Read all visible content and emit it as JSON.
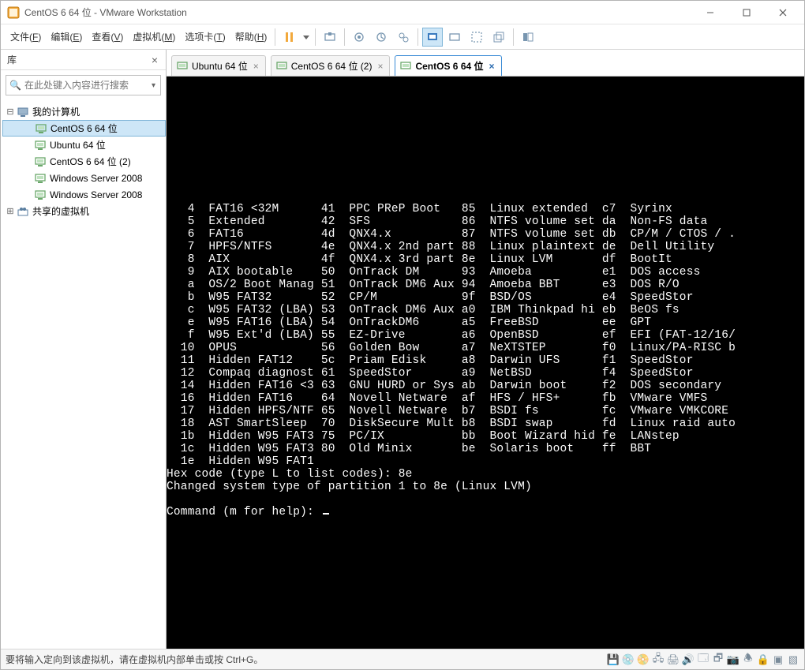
{
  "window": {
    "title": "CentOS 6 64 位 - VMware Workstation"
  },
  "menu": {
    "items": [
      {
        "label": "文件",
        "accel": "F"
      },
      {
        "label": "编辑",
        "accel": "E"
      },
      {
        "label": "查看",
        "accel": "V"
      },
      {
        "label": "虚拟机",
        "accel": "M"
      },
      {
        "label": "选项卡",
        "accel": "T"
      },
      {
        "label": "帮助",
        "accel": "H"
      }
    ]
  },
  "sidebar": {
    "title": "库",
    "search_placeholder": "在此处键入内容进行搜索",
    "root": {
      "label": "我的计算机"
    },
    "items": [
      {
        "label": "CentOS 6 64 位",
        "selected": true
      },
      {
        "label": "Ubuntu 64 位",
        "selected": false
      },
      {
        "label": "CentOS 6 64 位 (2)",
        "selected": false
      },
      {
        "label": "Windows Server 2008",
        "selected": false
      },
      {
        "label": "Windows Server 2008",
        "selected": false
      }
    ],
    "shared": {
      "label": "共享的虚拟机"
    }
  },
  "tabs": [
    {
      "label": "Ubuntu 64 位",
      "active": false
    },
    {
      "label": "CentOS 6 64 位 (2)",
      "active": false
    },
    {
      "label": "CentOS 6 64 位",
      "active": true
    }
  ],
  "console": {
    "rows": [
      {
        "c1": " 4",
        "n1": "FAT16 <32M",
        "c2": "41",
        "n2": "PPC PReP Boot",
        "c3": "85",
        "n3": "Linux extended",
        "c4": "c7",
        "n4": "Syrinx"
      },
      {
        "c1": " 5",
        "n1": "Extended",
        "c2": "42",
        "n2": "SFS",
        "c3": "86",
        "n3": "NTFS volume set",
        "c4": "da",
        "n4": "Non-FS data"
      },
      {
        "c1": " 6",
        "n1": "FAT16",
        "c2": "4d",
        "n2": "QNX4.x",
        "c3": "87",
        "n3": "NTFS volume set",
        "c4": "db",
        "n4": "CP/M / CTOS / ."
      },
      {
        "c1": " 7",
        "n1": "HPFS/NTFS",
        "c2": "4e",
        "n2": "QNX4.x 2nd part",
        "c3": "88",
        "n3": "Linux plaintext",
        "c4": "de",
        "n4": "Dell Utility"
      },
      {
        "c1": " 8",
        "n1": "AIX",
        "c2": "4f",
        "n2": "QNX4.x 3rd part",
        "c3": "8e",
        "n3": "Linux LVM",
        "c4": "df",
        "n4": "BootIt"
      },
      {
        "c1": " 9",
        "n1": "AIX bootable",
        "c2": "50",
        "n2": "OnTrack DM",
        "c3": "93",
        "n3": "Amoeba",
        "c4": "e1",
        "n4": "DOS access"
      },
      {
        "c1": " a",
        "n1": "OS/2 Boot Manag",
        "c2": "51",
        "n2": "OnTrack DM6 Aux",
        "c3": "94",
        "n3": "Amoeba BBT",
        "c4": "e3",
        "n4": "DOS R/O"
      },
      {
        "c1": " b",
        "n1": "W95 FAT32",
        "c2": "52",
        "n2": "CP/M",
        "c3": "9f",
        "n3": "BSD/OS",
        "c4": "e4",
        "n4": "SpeedStor"
      },
      {
        "c1": " c",
        "n1": "W95 FAT32 (LBA)",
        "c2": "53",
        "n2": "OnTrack DM6 Aux",
        "c3": "a0",
        "n3": "IBM Thinkpad hi",
        "c4": "eb",
        "n4": "BeOS fs"
      },
      {
        "c1": " e",
        "n1": "W95 FAT16 (LBA)",
        "c2": "54",
        "n2": "OnTrackDM6",
        "c3": "a5",
        "n3": "FreeBSD",
        "c4": "ee",
        "n4": "GPT"
      },
      {
        "c1": " f",
        "n1": "W95 Ext'd (LBA)",
        "c2": "55",
        "n2": "EZ-Drive",
        "c3": "a6",
        "n3": "OpenBSD",
        "c4": "ef",
        "n4": "EFI (FAT-12/16/"
      },
      {
        "c1": "10",
        "n1": "OPUS",
        "c2": "56",
        "n2": "Golden Bow",
        "c3": "a7",
        "n3": "NeXTSTEP",
        "c4": "f0",
        "n4": "Linux/PA-RISC b"
      },
      {
        "c1": "11",
        "n1": "Hidden FAT12",
        "c2": "5c",
        "n2": "Priam Edisk",
        "c3": "a8",
        "n3": "Darwin UFS",
        "c4": "f1",
        "n4": "SpeedStor"
      },
      {
        "c1": "12",
        "n1": "Compaq diagnost",
        "c2": "61",
        "n2": "SpeedStor",
        "c3": "a9",
        "n3": "NetBSD",
        "c4": "f4",
        "n4": "SpeedStor"
      },
      {
        "c1": "14",
        "n1": "Hidden FAT16 <3",
        "c2": "63",
        "n2": "GNU HURD or Sys",
        "c3": "ab",
        "n3": "Darwin boot",
        "c4": "f2",
        "n4": "DOS secondary"
      },
      {
        "c1": "16",
        "n1": "Hidden FAT16",
        "c2": "64",
        "n2": "Novell Netware",
        "c3": "af",
        "n3": "HFS / HFS+",
        "c4": "fb",
        "n4": "VMware VMFS"
      },
      {
        "c1": "17",
        "n1": "Hidden HPFS/NTF",
        "c2": "65",
        "n2": "Novell Netware",
        "c3": "b7",
        "n3": "BSDI fs",
        "c4": "fc",
        "n4": "VMware VMKCORE"
      },
      {
        "c1": "18",
        "n1": "AST SmartSleep",
        "c2": "70",
        "n2": "DiskSecure Mult",
        "c3": "b8",
        "n3": "BSDI swap",
        "c4": "fd",
        "n4": "Linux raid auto"
      },
      {
        "c1": "1b",
        "n1": "Hidden W95 FAT3",
        "c2": "75",
        "n2": "PC/IX",
        "c3": "bb",
        "n3": "Boot Wizard hid",
        "c4": "fe",
        "n4": "LANstep"
      },
      {
        "c1": "1c",
        "n1": "Hidden W95 FAT3",
        "c2": "80",
        "n2": "Old Minix",
        "c3": "be",
        "n3": "Solaris boot",
        "c4": "ff",
        "n4": "BBT"
      },
      {
        "c1": "1e",
        "n1": "Hidden W95 FAT1",
        "c2": "",
        "n2": "",
        "c3": "",
        "n3": "",
        "c4": "",
        "n4": ""
      }
    ],
    "trailer": [
      "Hex code (type L to list codes): 8e",
      "Changed system type of partition 1 to 8e (Linux LVM)",
      "",
      "Command (m for help): "
    ]
  },
  "statusbar": {
    "message": "要将输入定向到该虚拟机，请在虚拟机内部单击或按 Ctrl+G。"
  }
}
